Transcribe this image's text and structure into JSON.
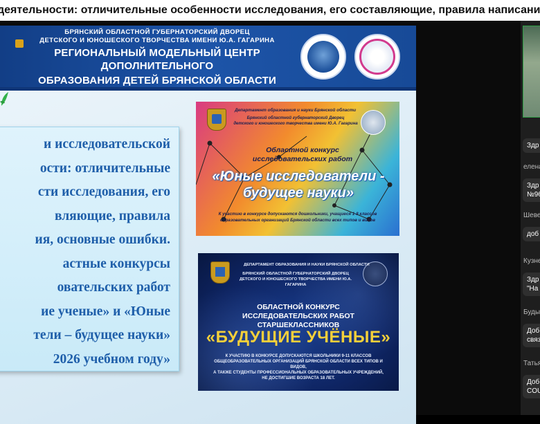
{
  "window": {
    "title": "деятельности: отличительные особенности исследования, его составляющие, правила написания, основные ошибки"
  },
  "slide": {
    "header": {
      "line1": "БРЯНСКИЙ ОБЛАСТНОЙ ГУБЕРНАТОРСКИЙ ДВОРЕЦ",
      "line2": "ДЕТСКОГО И ЮНОШЕСКОГО ТВОРЧЕСТВА ИМЕНИ Ю.А. ГАГАРИНА",
      "line3": "РЕГИОНАЛЬНЫЙ МОДЕЛЬНЫЙ ЦЕНТР ДОПОЛНИТЕЛЬНОГО",
      "line4": "ОБРАЗОВАНИЯ ДЕТЕЙ БРЯНСКОЙ ОБЛАСТИ"
    },
    "main_text_lines": [
      "и исследовательской",
      "ости: отличительные",
      "сти исследования, его",
      "вляющие, правила",
      "ия, основные ошибки.",
      "астные конкурсы",
      "овательских работ",
      "ие ученые» и «Юные",
      "тели – будущее науки»",
      "2026 учебном году»"
    ],
    "poster1": {
      "dept": "Департамент образования и науки Брянской области",
      "sub1": "Брянский областной губернаторский Дворец",
      "sub2": "детского и юношеского творчества имени Ю.А. Гагарина",
      "contest1": "Областной конкурс",
      "contest2": "исследовательских работ",
      "main1": "«Юные исследователи -",
      "main2": "будущее науки»",
      "foot1": "К участию в конкурсе допускаются дошкольники, учащиеся 1-8 классов",
      "foot2": "образовательных организаций Брянской области всех типов и видов"
    },
    "poster2": {
      "dept": "ДЕПАРТАМЕНТ ОБРАЗОВАНИЯ И НАУКИ БРЯНСКОЙ ОБЛАСТИ",
      "sub1": "БРЯНСКИЙ ОБЛАСТНОЙ ГУБЕРНАТОРСКИЙ ДВОРЕЦ",
      "sub2": "ДЕТСКОГО И ЮНОШЕСКОГО ТВОРЧЕСТВА ИМЕНИ Ю.А. ГАГАРИНА",
      "contest1": "ОБЛАСТНОЙ КОНКУРС",
      "contest2": "ИССЛЕДОВАТЕЛЬСКИХ РАБОТ СТАРШЕКЛАССНИКОВ",
      "main": "«БУДУЩИЕ УЧЁНЫЕ»",
      "foot1": "К УЧАСТИЮ В КОНКУРСЕ ДОПУСКАЮТСЯ ШКОЛЬНИКИ 9-11 КЛАССОВ",
      "foot2": "ОБЩЕОБРАЗОВАТЕЛЬНЫХ ОРГАНИЗАЦИЙ БРЯНСКОЙ ОБЛАСТИ ВСЕХ ТИПОВ И ВИДОВ,",
      "foot3": "А ТАКЖЕ СТУДЕНТЫ ПРОФЕССИОНАЛЬНЫХ ОБРАЗОВАТЕЛЬНЫХ УЧРЕЖДЕНИЙ,",
      "foot4": "НЕ ДОСТИГШИЕ ВОЗРАСТА 18 ЛЕТ."
    }
  },
  "chat": {
    "messages": [
      {
        "name": "",
        "lines": [
          "Здр"
        ]
      },
      {
        "name": "елена",
        "lines": [
          "Здр",
          "№96"
        ]
      },
      {
        "name": "Шеве",
        "lines": [
          "доб"
        ]
      },
      {
        "name": "Кузне",
        "lines": [
          "Здр",
          "\"На"
        ]
      },
      {
        "name": "Буды",
        "lines": [
          "Доб",
          "связ"
        ]
      },
      {
        "name": "Татья",
        "lines": [
          "Доб",
          "COU"
        ]
      }
    ]
  }
}
